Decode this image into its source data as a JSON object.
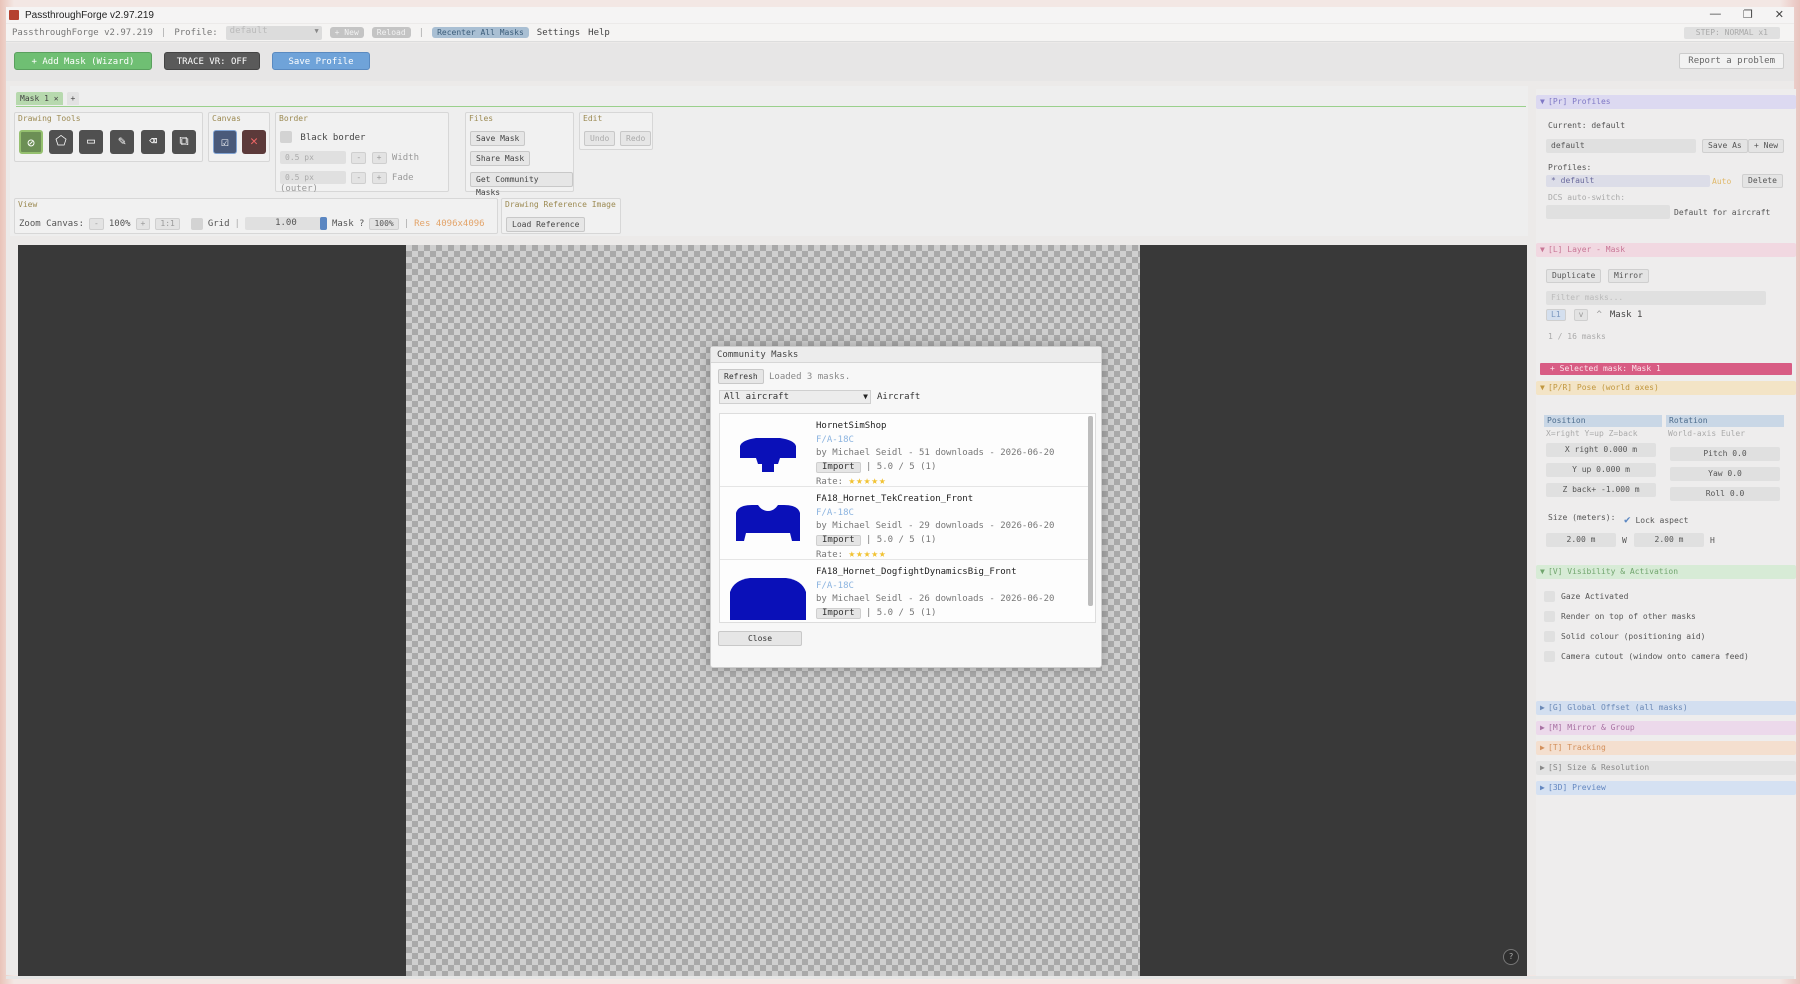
{
  "window": {
    "title": "PassthroughForge v2.97.219",
    "controls": [
      "—",
      "❐",
      "✕"
    ]
  },
  "menubar": {
    "app_label": "PassthroughForge v2.97.219",
    "profile_label": "Profile:",
    "profile_value": "default",
    "new_label": "+ New",
    "reload_label": "Reload",
    "recenter_label": "Recenter All Masks",
    "settings_label": "Settings",
    "help_label": "Help",
    "step_label": "STEP: NORMAL  x1"
  },
  "toolbar": {
    "add_mask_label": "+ Add Mask  (Wizard)",
    "trace_label": "TRACE VR: OFF",
    "save_profile_label": "Save Profile",
    "report_label": "Report a problem"
  },
  "tabs": [
    {
      "label": "Mask 1 ✕"
    },
    {
      "label": "+"
    }
  ],
  "drawing_tools": {
    "title": "Drawing Tools",
    "tools": [
      {
        "name": "ellipse-tool-icon",
        "glyph": "⊘"
      },
      {
        "name": "polygon-tool-icon",
        "glyph": "⬠"
      },
      {
        "name": "rect-tool-icon",
        "glyph": "▭"
      },
      {
        "name": "pen-tool-icon",
        "glyph": "✎"
      },
      {
        "name": "eraser-tool-icon",
        "glyph": "⌫"
      },
      {
        "name": "crop-tool-icon",
        "glyph": "⧉"
      }
    ]
  },
  "canvas_group": {
    "title": "Canvas"
  },
  "border": {
    "title": "Border",
    "black_border_label": "Black border",
    "width_value": "0.5 px",
    "width_label": "Width",
    "fade_value": "0.5 px",
    "fade_label": "Fade (outer)"
  },
  "files": {
    "title": "Files",
    "save_mask_label": "Save Mask",
    "share_mask_label": "Share Mask",
    "community_label": "Get Community Masks"
  },
  "edit": {
    "title": "Edit",
    "undo_label": "Undo",
    "redo_label": "Redo"
  },
  "view": {
    "title": "View",
    "zoom_label": "Zoom Canvas:",
    "zoom_minus": "-",
    "zoom_value": "100%",
    "zoom_plus": "+",
    "zoom_reset": "1:1",
    "grid_label": "Grid",
    "slider_value": "1.00",
    "mask_label": "Mask ?",
    "mask_pct": "100%",
    "res_label": "Res 4096x4096"
  },
  "reference": {
    "title": "Drawing Reference Image",
    "load_label": "Load Reference"
  },
  "modal": {
    "title": "Community Masks",
    "refresh_label": "Refresh",
    "status": "Loaded 3 masks.",
    "filter_value": "All aircraft",
    "filter_label": "Aircraft",
    "close_label": "Close",
    "rate_label": "Rate:",
    "import_label": "Import",
    "items": [
      {
        "name": "HornetSimShop",
        "aircraft": "F/A-18C",
        "meta": "by Michael Seidl  -  51 downloads  -  2026-06-20",
        "rating": "|  5.0 / 5  (1)",
        "stars": "★★★★★"
      },
      {
        "name": "FA18_Hornet_TekCreation_Front",
        "aircraft": "F/A-18C",
        "meta": "by Michael Seidl  -  29 downloads  -  2026-06-20",
        "rating": "|  5.0 / 5  (1)",
        "stars": "★★★★★"
      },
      {
        "name": "FA18_Hornet_DogfightDynamicsBig_Front",
        "aircraft": "F/A-18C",
        "meta": "by Michael Seidl  -  26 downloads  -  2026-06-20",
        "rating": "|  5.0 / 5  (1)",
        "stars": "★★★★★"
      }
    ]
  },
  "right": {
    "profiles": {
      "header": "[Pr] Profiles",
      "current_label": "Current: default",
      "name_value": "default",
      "save_as_label": "Save As",
      "new_label": "+ New",
      "profiles_label": "Profiles:",
      "profile_item": "* default",
      "auto_label": "Auto",
      "delete_label": "Delete",
      "dcs_label": "DCS auto-switch:",
      "default_aircraft_label": "Default for aircraft"
    },
    "layer": {
      "header": "[L] Layer - Mask",
      "duplicate_label": "Duplicate",
      "mirror_label": "Mirror",
      "filter_placeholder": "Filter masks...",
      "row_tag": "L1",
      "row_eye": "v",
      "row_up": "^",
      "row_name": "Mask 1",
      "count_label": "1 / 16 masks"
    },
    "selected_label": "+  Selected mask: Mask 1",
    "pose": {
      "header": "[P/R] Pose (world axes)",
      "position_label": "Position",
      "rotation_label": "Rotation",
      "pos_hint": "X=right Y=up Z=back",
      "rot_hint": "World-axis Euler",
      "x_value": "X right  0.000 m",
      "y_value": "Y up   0.000 m",
      "z_value": "Z back+ -1.000 m",
      "pitch_value": "Pitch 0.0",
      "yaw_value": "Yaw  0.0",
      "roll_value": "Roll  0.0",
      "size_label": "Size (meters):",
      "lock_label": "Lock aspect",
      "w_value": "2.00 m",
      "w_label": "W",
      "h_value": "2.00 m",
      "h_label": "H"
    },
    "visibility": {
      "header": "[V] Visibility & Activation",
      "rows": [
        "Gaze Activated",
        "Render on top of other masks",
        "Solid colour (positioning aid)",
        "Camera cutout (window onto camera feed)"
      ]
    },
    "collapsed": {
      "global": "[G] Global Offset (all masks)",
      "mirror": "[M] Mirror & Group",
      "tracking": "[T] Tracking",
      "size": "[S] Size & Resolution",
      "preview": "[3D] Preview"
    }
  },
  "colors": {
    "mask_blue": "#0a10b8",
    "accent_green": "#6fbf73",
    "accent_blue": "#6fa3d9",
    "selected_pink": "#d85c84"
  }
}
